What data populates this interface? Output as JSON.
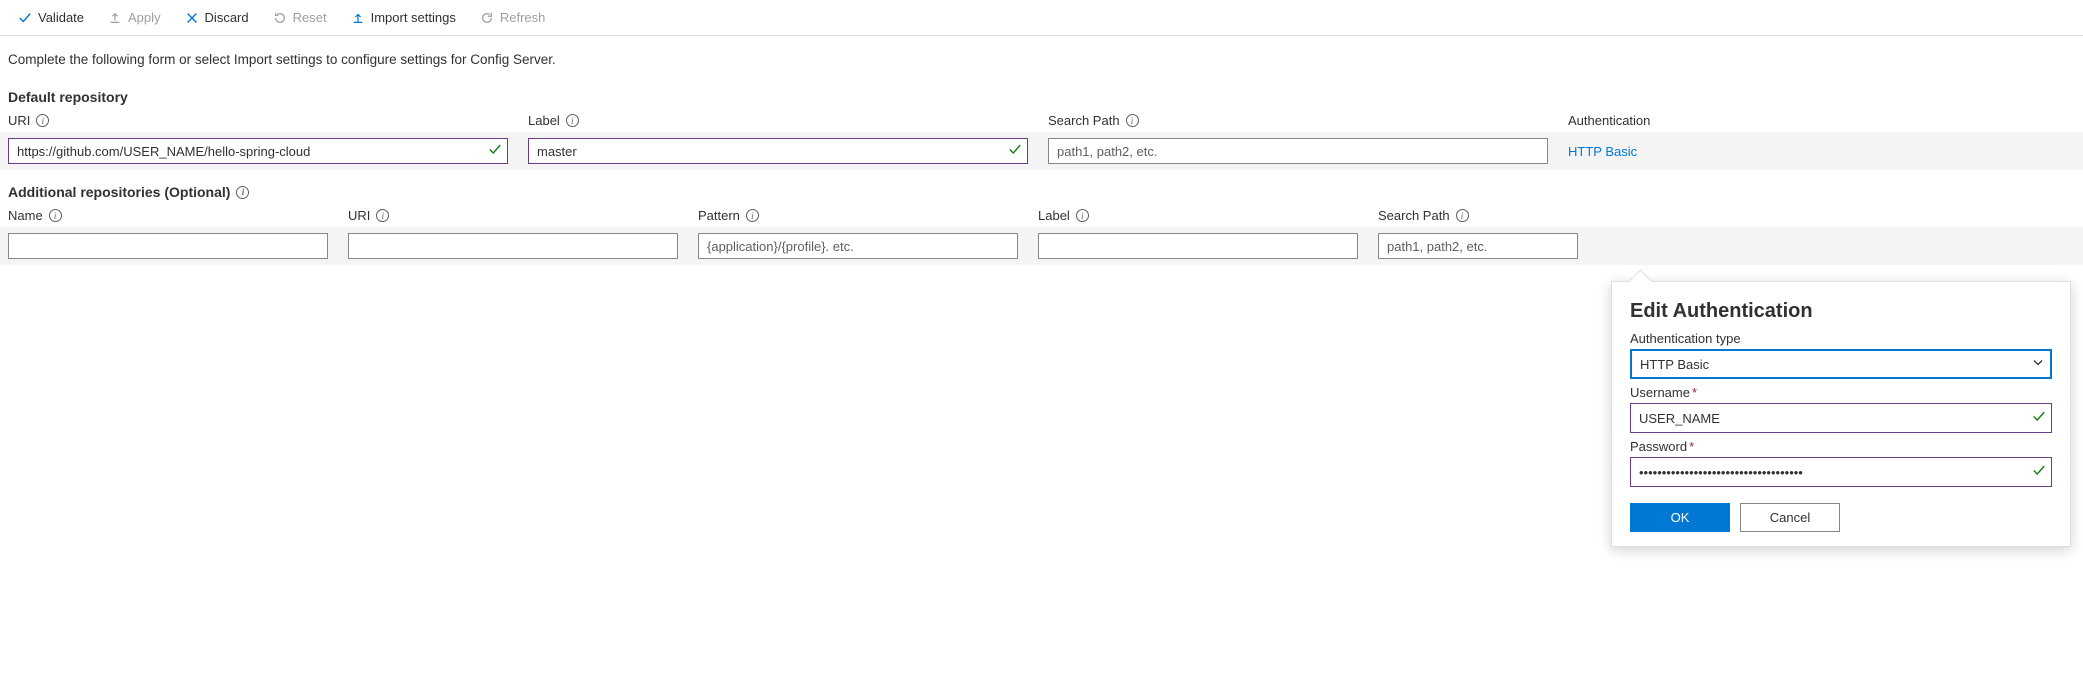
{
  "toolbar": {
    "validate": "Validate",
    "apply": "Apply",
    "discard": "Discard",
    "reset": "Reset",
    "import": "Import settings",
    "refresh": "Refresh"
  },
  "intro": "Complete the following form or select Import settings to configure settings for Config Server.",
  "default_repo": {
    "title": "Default repository",
    "headers": {
      "uri": "URI",
      "label": "Label",
      "search": "Search Path",
      "auth": "Authentication"
    },
    "uri": "https://github.com/USER_NAME/hello-spring-cloud",
    "label": "master",
    "search_placeholder": "path1, path2, etc.",
    "auth_link": "HTTP Basic"
  },
  "additional": {
    "title": "Additional repositories (Optional)",
    "headers": {
      "name": "Name",
      "uri": "URI",
      "pattern": "Pattern",
      "label": "Label",
      "search": "Search Path"
    },
    "pattern_placeholder": "{application}/{profile}. etc.",
    "search_placeholder": "path1, path2, etc."
  },
  "popover": {
    "title": "Edit Authentication",
    "type_label": "Authentication type",
    "type_value": "HTTP Basic",
    "username_label": "Username",
    "username_value": "USER_NAME",
    "password_label": "Password",
    "password_value": "••••••••••••••••••••••••••••••••••••",
    "ok": "OK",
    "cancel": "Cancel"
  }
}
